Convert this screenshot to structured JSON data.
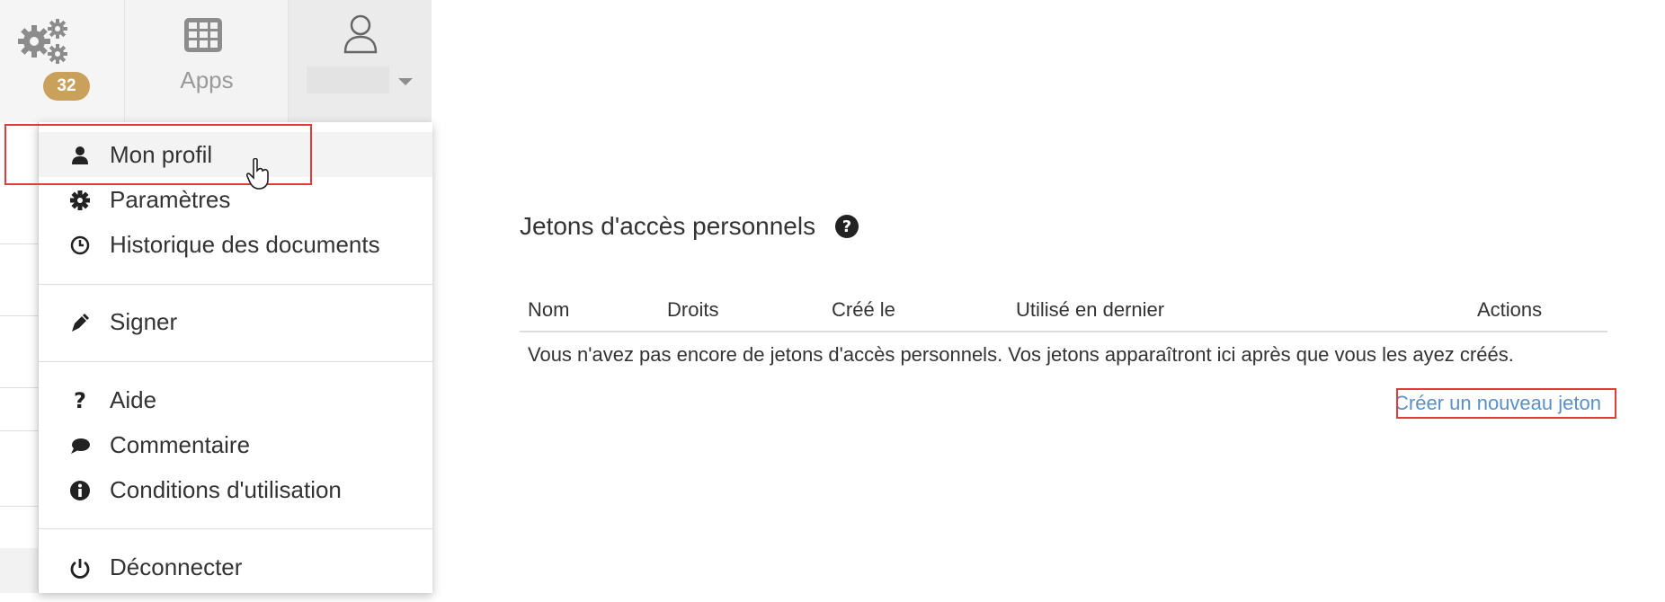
{
  "header": {
    "notification_count": "32",
    "apps_label": "Apps"
  },
  "user_menu": {
    "items": [
      {
        "label": "Mon profil",
        "icon": "user-icon"
      },
      {
        "label": "Paramètres",
        "icon": "gear-icon"
      },
      {
        "label": "Historique des documents",
        "icon": "clock-icon"
      },
      {
        "label": "Signer",
        "icon": "pen-icon"
      },
      {
        "label": "Aide",
        "icon": "question-icon"
      },
      {
        "label": "Commentaire",
        "icon": "comment-icon"
      },
      {
        "label": "Conditions d'utilisation",
        "icon": "info-icon"
      },
      {
        "label": "Déconnecter",
        "icon": "power-icon"
      }
    ]
  },
  "tokens": {
    "title": "Jetons d'accès personnels",
    "columns": [
      "Nom",
      "Droits",
      "Créé le",
      "Utilisé en dernier",
      "Actions"
    ],
    "empty_message": "Vous n'avez pas encore de jetons d'accès personnels. Vos jetons apparaîtront ici après que vous les ayez créés.",
    "create_link": "Créer un nouveau jeton"
  },
  "colors": {
    "badge": "#c9a15a",
    "highlight": "#e03c3c",
    "link": "#5b8fc7"
  }
}
